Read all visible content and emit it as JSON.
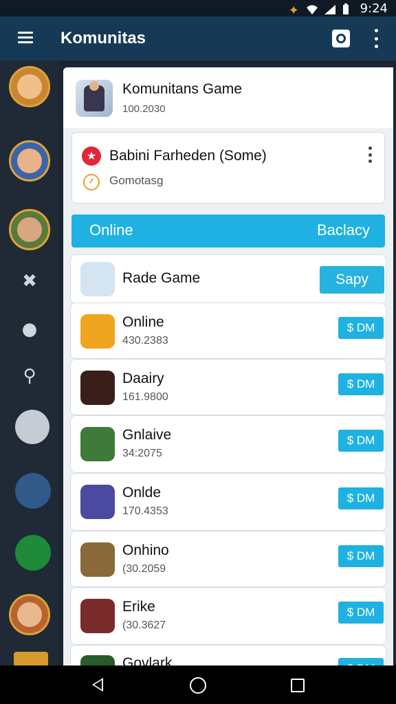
{
  "status_bar": {
    "time": "9:24"
  },
  "app_bar": {
    "title": "Komunitas",
    "icons": [
      "menu-icon",
      "chat-icon",
      "more-vert-icon"
    ]
  },
  "header": {
    "title": "Komunitans Game",
    "subtitle": "100.2030"
  },
  "profile": {
    "name": "Babini Farheden (Some)",
    "status": "Gomotasg",
    "icons": [
      "star-icon",
      "clock-icon",
      "more-vert-icon"
    ]
  },
  "tabs": {
    "left": "Online",
    "right": "Baclacy"
  },
  "featured": {
    "title": "Rade Game",
    "button": "Sapy"
  },
  "games": [
    {
      "title": "Online",
      "meta": "430.2383",
      "price": "$ DM"
    },
    {
      "title": "Daairy",
      "meta": "161.9800",
      "price": "$ DM"
    },
    {
      "title": "Gnlaive",
      "meta": "34:2075",
      "price": "$ DM"
    },
    {
      "title": "Onlde",
      "meta": "170.4353",
      "price": "$ DM"
    },
    {
      "title": "Onhino",
      "meta": "(30.2059",
      "price": "$ DM"
    },
    {
      "title": "Erike",
      "meta": "(30.3627",
      "price": "$ DM"
    },
    {
      "title": "Govlark",
      "meta": "",
      "price": "$ DM"
    }
  ],
  "colors": {
    "app_bar": "#163a55",
    "rail": "#1f2a36",
    "accent": "#1fb1e2",
    "star": "#e02838"
  }
}
